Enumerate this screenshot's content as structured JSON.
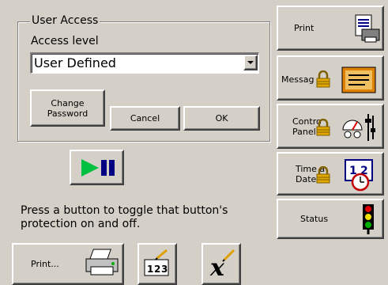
{
  "user_access": {
    "group_title": "User Access",
    "access_level_label": "Access level",
    "access_level_value": "User Defined",
    "change_password_label": "Change\nPassword",
    "cancel_label": "Cancel",
    "ok_label": "OK"
  },
  "instructions": "Press a button to toggle that button's\nprotection on and off.",
  "side_buttons": {
    "print": "Print",
    "messages": "Messag",
    "control_panel": "Contro\nPanel",
    "time_date": "Time a\nDate",
    "status": "Status"
  },
  "bottom_buttons": {
    "print_dots": "Print..."
  },
  "icons": {
    "play_pause_color_play": "#00c040",
    "lock_color": "#e0a800",
    "status_light_colors": [
      "#e00000",
      "#f0e000",
      "#00b000"
    ]
  }
}
